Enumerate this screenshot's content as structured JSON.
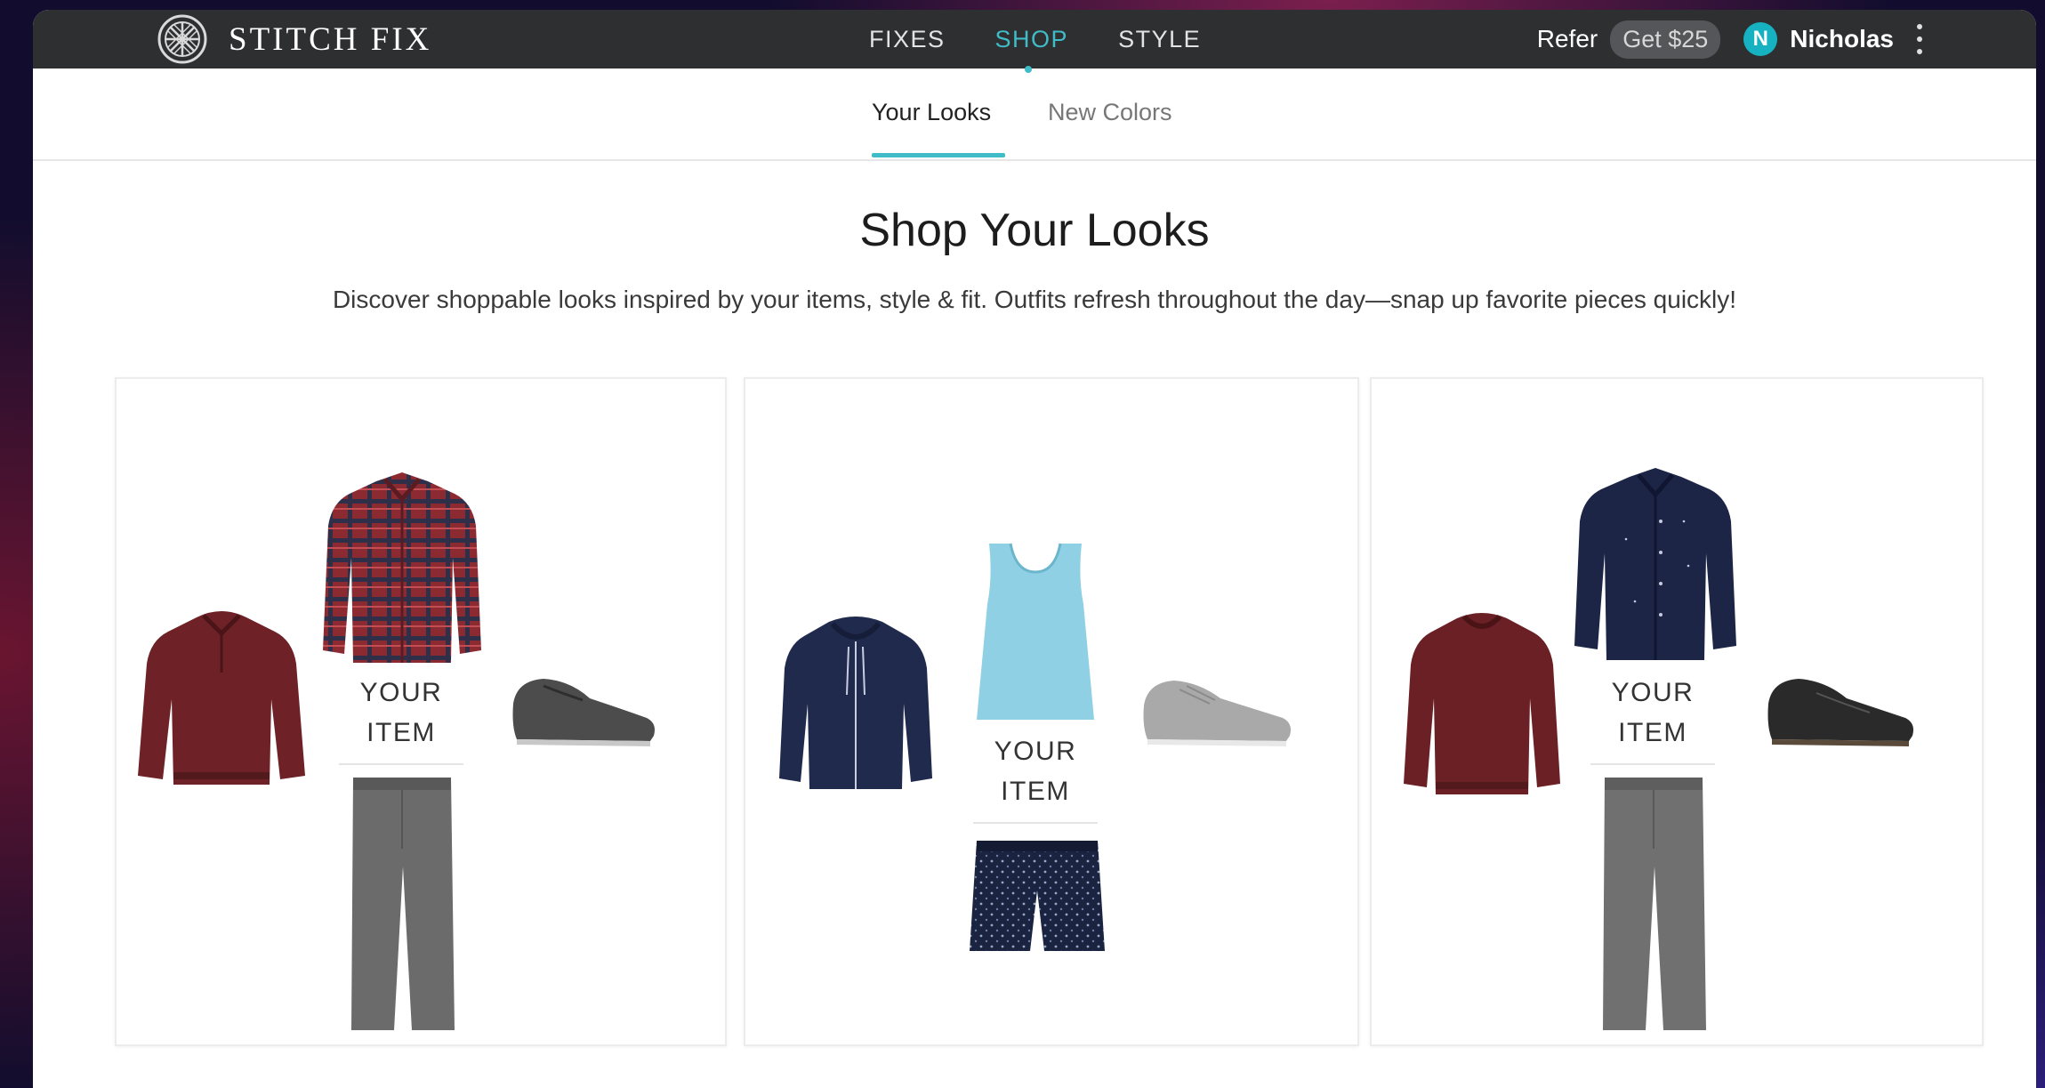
{
  "brand": {
    "name": "STITCH FIX",
    "icon": "stitch-fix-logo-icon",
    "accent_color": "#3fbcc8",
    "topbar_color": "#2e2f31"
  },
  "nav": {
    "items": [
      {
        "label": "FIXES"
      },
      {
        "label": "SHOP"
      },
      {
        "label": "STYLE"
      }
    ],
    "active": "SHOP"
  },
  "account": {
    "refer_label": "Refer",
    "refer_badge": "Get $25",
    "avatar_initial": "N",
    "username": "Nicholas",
    "menu_icon": "kebab-menu-icon"
  },
  "subnav": {
    "tabs": [
      {
        "label": "Your Looks"
      },
      {
        "label": "New Colors"
      }
    ],
    "active": "Your Looks"
  },
  "main": {
    "title": "Shop Your Looks",
    "description": "Discover shoppable looks inspired by your items, style & fit. Outfits refresh throughout the day—snap up favorite pieces quickly!"
  },
  "looks": [
    {
      "your_item_line1": "YOUR",
      "your_item_line2": "ITEM",
      "items": [
        "burgundy-quarter-zip-sweater-icon",
        "red-plaid-shirt-icon",
        "dark-gray-shoe-icon",
        "gray-pants-icon"
      ]
    },
    {
      "your_item_line1": "YOUR",
      "your_item_line2": "ITEM",
      "items": [
        "navy-zip-hoodie-icon",
        "light-blue-tank-top-icon",
        "light-gray-sneaker-icon",
        "navy-print-shorts-icon"
      ]
    },
    {
      "your_item_line1": "YOUR",
      "your_item_line2": "ITEM",
      "items": [
        "burgundy-sweater-icon",
        "navy-button-shirt-icon",
        "black-dress-shoe-icon",
        "gray-pants-icon"
      ]
    }
  ]
}
